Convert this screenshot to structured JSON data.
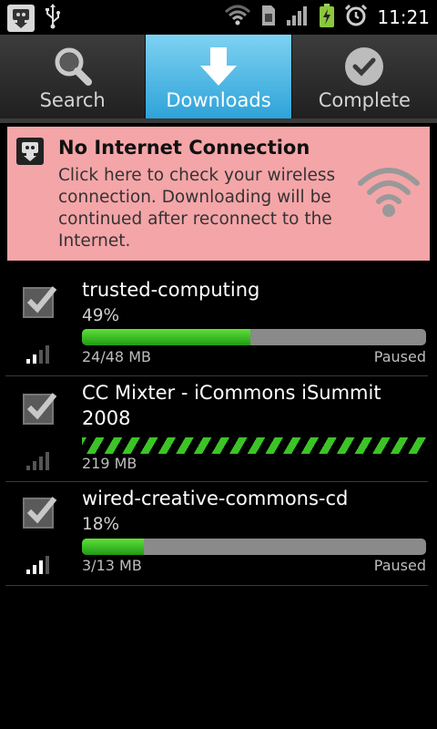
{
  "status_bar": {
    "time": "11:21"
  },
  "tabs": [
    {
      "label": "Search",
      "icon": "search-icon",
      "active": false
    },
    {
      "label": "Downloads",
      "icon": "download-arrow-icon",
      "active": true
    },
    {
      "label": "Complete",
      "icon": "check-circle-icon",
      "active": false
    }
  ],
  "banner": {
    "title": "No Internet Connection",
    "text": "Click here to check your wireless connection. Downloading will be continued after reconnect to the Internet.",
    "color": "#f4a5a8"
  },
  "downloads": [
    {
      "name": "trusted-computing",
      "percent_label": "49%",
      "progress": 0.49,
      "size": "24/48 MB",
      "status": "Paused"
    },
    {
      "name": "CC Mixter - iCommons iSummit 2008",
      "percent_label": "",
      "progress": null,
      "size": "219 MB",
      "status": ""
    },
    {
      "name": "wired-creative-commons-cd",
      "percent_label": "18%",
      "progress": 0.18,
      "size": "3/13 MB",
      "status": "Paused"
    }
  ],
  "colors": {
    "accent_tab": "#2ea3d9",
    "progress_green": "#3cc427"
  }
}
